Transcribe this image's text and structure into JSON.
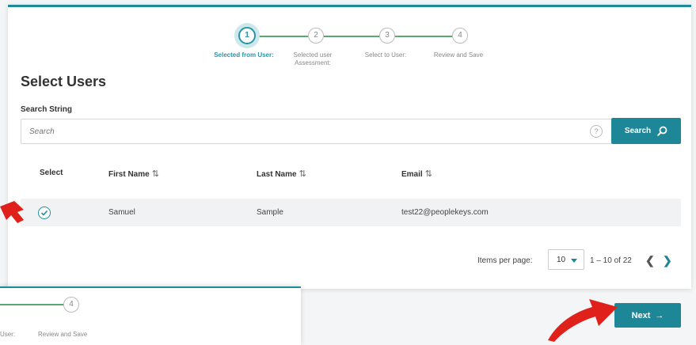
{
  "stepper": {
    "steps": [
      {
        "number": "1",
        "label": "Selected from User:"
      },
      {
        "number": "2",
        "label": "Selected user Assessment:"
      },
      {
        "number": "3",
        "label": "Select to User:"
      },
      {
        "number": "4",
        "label": "Review and Save"
      }
    ]
  },
  "page": {
    "title": "Select Users",
    "search_label": "Search String",
    "search_placeholder": "Search",
    "help_symbol": "?",
    "search_button": "Search"
  },
  "table": {
    "headers": [
      "Select",
      "First Name",
      "Last Name",
      "Email"
    ],
    "sort_symbol": "⇅",
    "rows": [
      {
        "selected": true,
        "first_name": "Samuel",
        "last_name": "Sample",
        "email": "test22@peoplekeys.com"
      }
    ]
  },
  "pagination": {
    "items_per_page_label": "Items per page:",
    "page_size": "10",
    "range": "1 – 10 of 22",
    "prev_symbol": "❮",
    "next_symbol": "❯"
  },
  "footer": {
    "next_button": "Next",
    "next_arrow": "→"
  },
  "inset": {
    "step_number": "4",
    "label_partial": "User:",
    "label_review": "Review and Save"
  },
  "colors": {
    "primary": "#1e8797",
    "step_line": "#5aa870",
    "annotation_arrow": "#e0201b"
  },
  "icons": {
    "search": "magnifier-icon",
    "check": "check-circle-icon",
    "arrow": "red-annotation-arrow"
  }
}
